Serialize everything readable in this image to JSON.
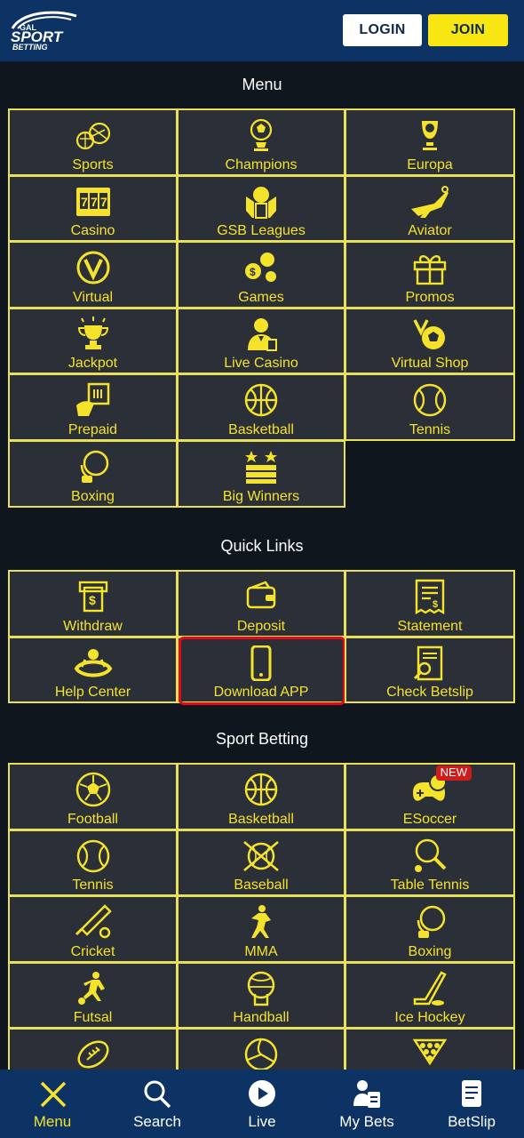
{
  "header": {
    "logo_text_top": "GAL",
    "logo_text_mid": "SPORT",
    "logo_text_bot": "BETTING",
    "login_label": "LOGIN",
    "join_label": "JOIN"
  },
  "menu": {
    "title": "Menu",
    "items": [
      {
        "label": "Sports",
        "icon": "sports-balls-icon"
      },
      {
        "label": "Champions",
        "icon": "champions-trophy-icon"
      },
      {
        "label": "Europa",
        "icon": "europa-trophy-icon"
      },
      {
        "label": "Casino",
        "icon": "slot-777-icon"
      },
      {
        "label": "GSB Leagues",
        "icon": "leagues-shield-icon"
      },
      {
        "label": "Aviator",
        "icon": "airplane-icon"
      },
      {
        "label": "Virtual",
        "icon": "virtual-v-icon"
      },
      {
        "label": "Games",
        "icon": "games-coins-icon"
      },
      {
        "label": "Promos",
        "icon": "gift-icon"
      },
      {
        "label": "Jackpot",
        "icon": "jackpot-trophy-icon"
      },
      {
        "label": "Live Casino",
        "icon": "dealer-icon"
      },
      {
        "label": "Virtual Shop",
        "icon": "virtual-shop-icon"
      },
      {
        "label": "Prepaid",
        "icon": "prepaid-card-icon"
      },
      {
        "label": "Basketball",
        "icon": "basketball-icon"
      },
      {
        "label": "Tennis",
        "icon": "tennis-ball-icon"
      },
      {
        "label": "Boxing",
        "icon": "boxing-glove-icon"
      },
      {
        "label": "Big Winners",
        "icon": "money-stack-icon"
      }
    ]
  },
  "quick_links": {
    "title": "Quick Links",
    "items": [
      {
        "label": "Withdraw",
        "icon": "atm-withdraw-icon"
      },
      {
        "label": "Deposit",
        "icon": "wallet-icon"
      },
      {
        "label": "Statement",
        "icon": "statement-receipt-icon"
      },
      {
        "label": "Help Center",
        "icon": "lifebuoy-icon"
      },
      {
        "label": "Download APP",
        "icon": "smartphone-icon"
      },
      {
        "label": "Check Betslip",
        "icon": "check-betslip-icon"
      }
    ]
  },
  "sport_betting": {
    "title": "Sport Betting",
    "new_badge": "NEW",
    "items": [
      {
        "label": "Football",
        "icon": "football-icon"
      },
      {
        "label": "Basketball",
        "icon": "basketball-icon"
      },
      {
        "label": "ESoccer",
        "icon": "gamepad-ball-icon"
      },
      {
        "label": "Tennis",
        "icon": "tennis-ball-icon"
      },
      {
        "label": "Baseball",
        "icon": "baseball-icon"
      },
      {
        "label": "Table Tennis",
        "icon": "table-tennis-icon"
      },
      {
        "label": "Cricket",
        "icon": "cricket-icon"
      },
      {
        "label": "MMA",
        "icon": "mma-fighter-icon"
      },
      {
        "label": "Boxing",
        "icon": "boxing-glove-icon"
      },
      {
        "label": "Futsal",
        "icon": "futsal-player-icon"
      },
      {
        "label": "Handball",
        "icon": "handball-icon"
      },
      {
        "label": "Ice Hockey",
        "icon": "ice-hockey-icon"
      },
      {
        "label": "",
        "icon": "american-football-icon"
      },
      {
        "label": "",
        "icon": "volleyball-icon"
      },
      {
        "label": "",
        "icon": "snooker-icon"
      }
    ]
  },
  "bottom_nav": {
    "items": [
      {
        "label": "Menu",
        "icon": "close-icon"
      },
      {
        "label": "Search",
        "icon": "search-icon"
      },
      {
        "label": "Live",
        "icon": "play-icon"
      },
      {
        "label": "My Bets",
        "icon": "my-bets-icon"
      },
      {
        "label": "BetSlip",
        "icon": "betslip-icon"
      }
    ]
  },
  "colors": {
    "header_bg": "#0d3364",
    "page_bg": "#0f161e",
    "cell_bg": "#2b3038",
    "accent_yellow": "#f5e22b",
    "highlight_red": "#e10b14"
  }
}
